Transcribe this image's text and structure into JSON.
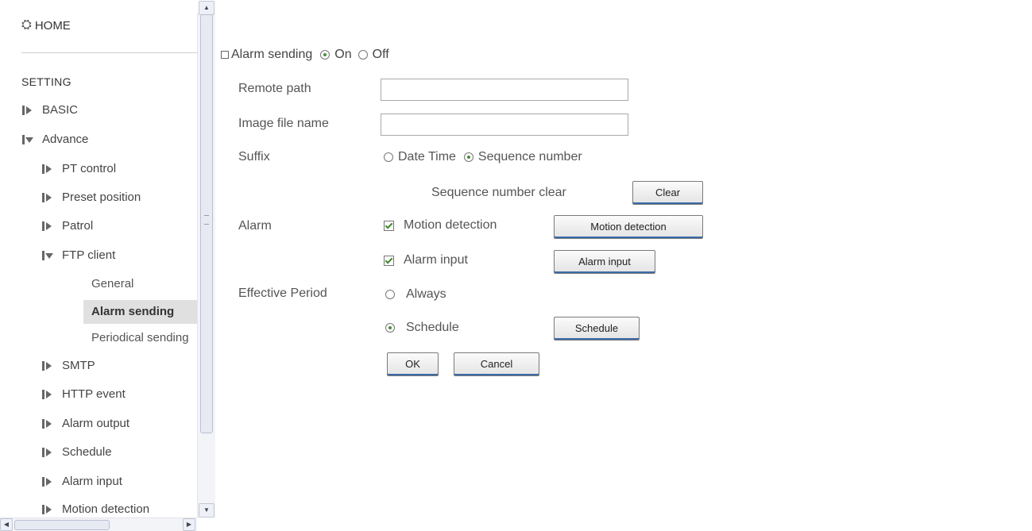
{
  "nav": {
    "home_label": "HOME",
    "setting_heading": "SETTING",
    "items": [
      {
        "label": "BASIC"
      },
      {
        "label": "Advance"
      },
      {
        "label": "PT control"
      },
      {
        "label": "Preset position"
      },
      {
        "label": "Patrol"
      },
      {
        "label": "FTP client"
      },
      {
        "label": "SMTP"
      },
      {
        "label": "HTTP event"
      },
      {
        "label": "Alarm output"
      },
      {
        "label": "Schedule"
      },
      {
        "label": "Alarm input"
      },
      {
        "label": "Motion detection"
      }
    ],
    "ftp_sub": [
      {
        "label": "General"
      },
      {
        "label": "Alarm sending"
      },
      {
        "label": "Periodical sending"
      }
    ]
  },
  "form": {
    "title": "Alarm sending",
    "alarm_sending_on": "On",
    "alarm_sending_off": "Off",
    "alarm_sending_selected": "On",
    "remote_path_label": "Remote path",
    "remote_path_value": "",
    "image_file_name_label": "Image file name",
    "image_file_name_value": "",
    "suffix_label": "Suffix",
    "suffix_date_time": "Date Time",
    "suffix_sequence": "Sequence number",
    "suffix_selected": "Sequence number",
    "seq_clear_label": "Sequence number clear",
    "clear_button": "Clear",
    "alarm_label": "Alarm",
    "motion_detection_check": "Motion detection",
    "motion_detection_checked": true,
    "motion_detection_button": "Motion detection",
    "alarm_input_check": "Alarm input",
    "alarm_input_checked": true,
    "alarm_input_button": "Alarm input",
    "effective_period_label": "Effective Period",
    "always_label": "Always",
    "schedule_label": "Schedule",
    "effective_period_selected": "Schedule",
    "schedule_button": "Schedule",
    "ok_button": "OK",
    "cancel_button": "Cancel"
  },
  "colors": {
    "accent_green": "#4a8b3a",
    "active_nav_bg": "#e0e0e0",
    "button_focus_blue": "#3a6aa8"
  }
}
